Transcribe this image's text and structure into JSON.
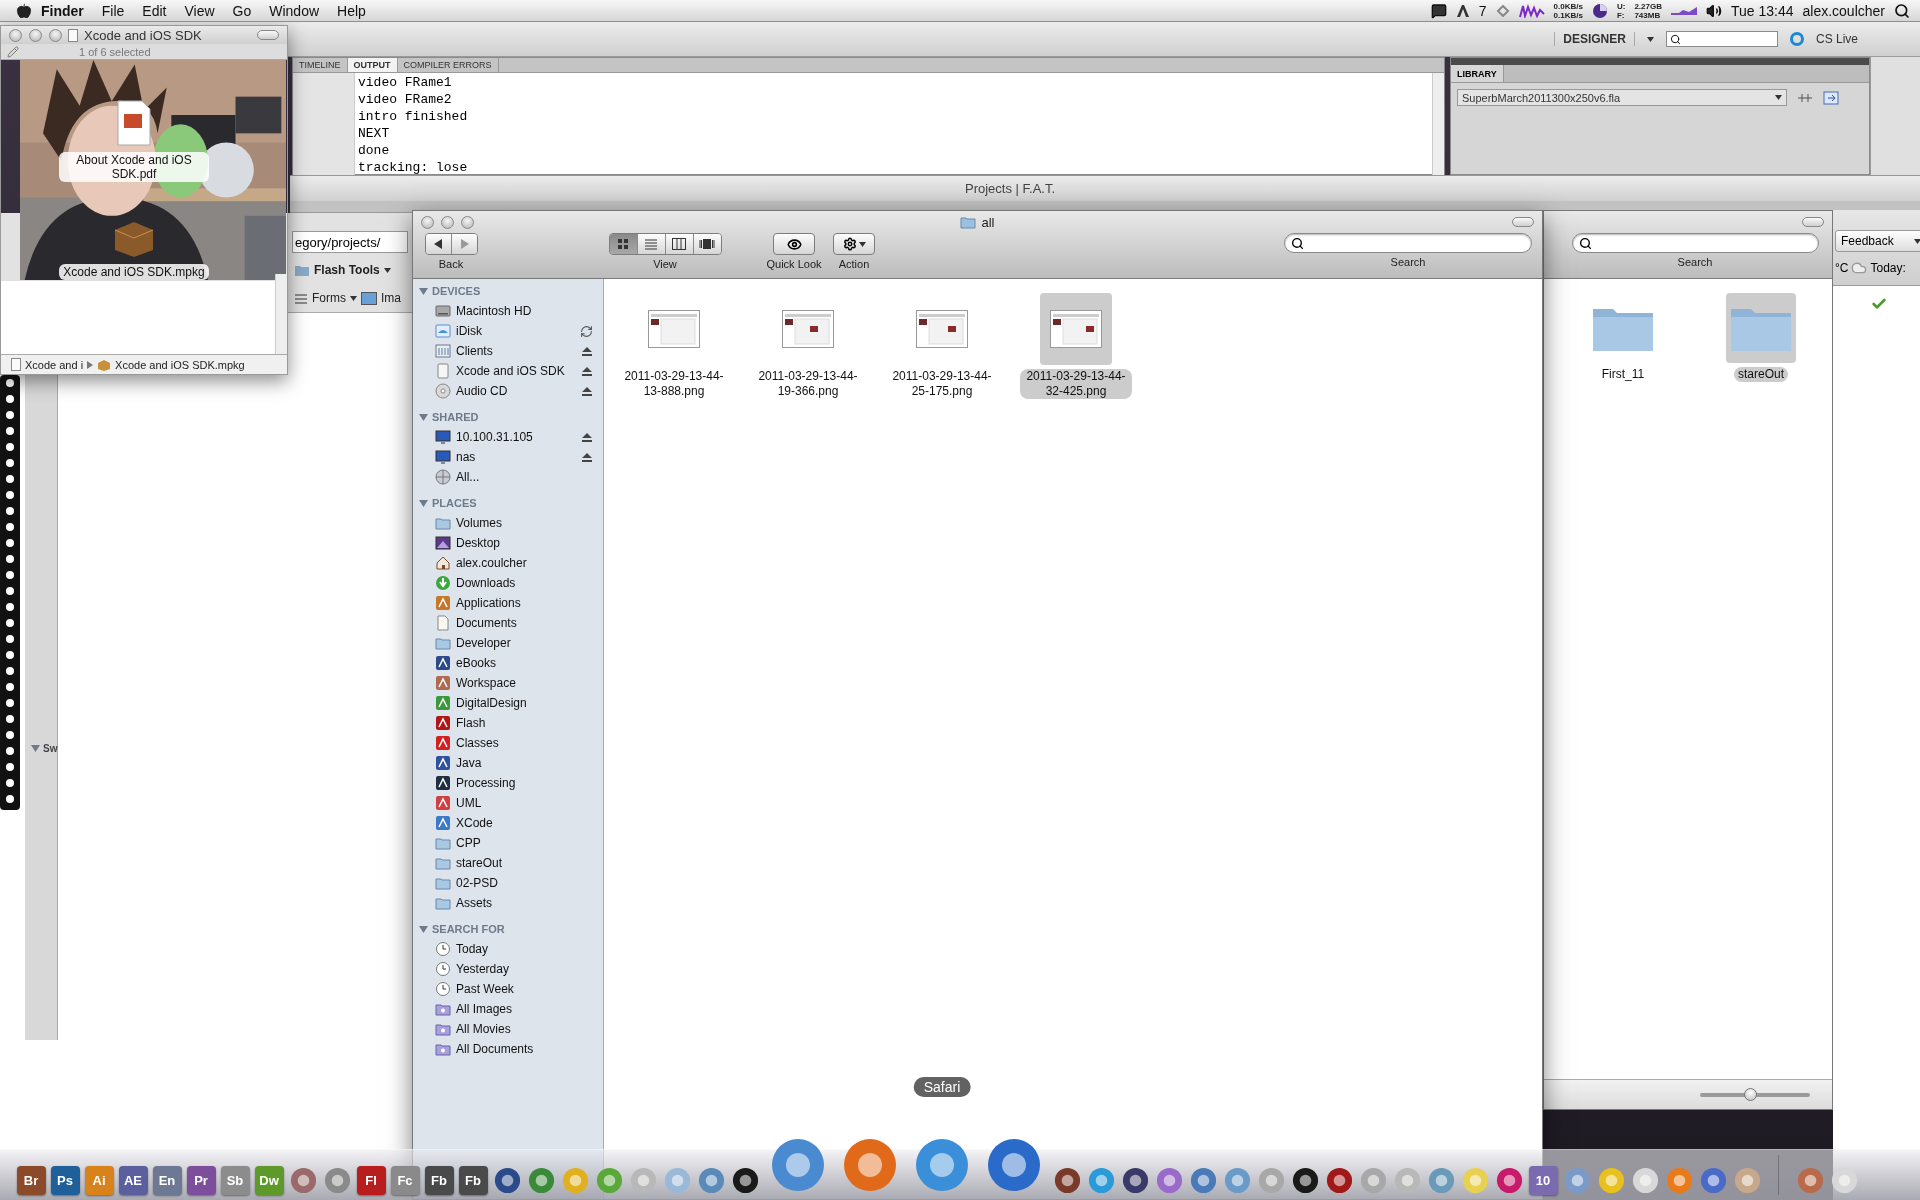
{
  "menu_bar": {
    "app": "Finder",
    "menus": [
      "File",
      "Edit",
      "View",
      "Go",
      "Window",
      "Help"
    ],
    "badge": "7",
    "net_up": "0.0KB/s",
    "net_down": "0.1KB/s",
    "mem_labels": [
      "U:",
      "F:"
    ],
    "mem_values": [
      "2.27GB",
      "743MB"
    ],
    "clock": "Tue 13:44",
    "user": "alex.coulcher"
  },
  "flash": {
    "workspace": "DESIGNER",
    "cs_live": "CS Live",
    "output_tabs": [
      {
        "label": "TIMELINE",
        "selected": false
      },
      {
        "label": "OUTPUT",
        "selected": true
      },
      {
        "label": "COMPILER ERRORS",
        "selected": false
      }
    ],
    "output_lines": [
      "video FRame1",
      "video FRame2",
      "intro finished",
      "NEXT",
      "done",
      "tracking: lose"
    ],
    "library_tab": "LIBRARY",
    "library_document": "SuperbMarch2011300x250v6.fla",
    "project_title": "Projects | F.A.T."
  },
  "browser": {
    "address": "egory/projects/",
    "folder_bar": "Flash Tools",
    "bookmarks": [
      "Forms",
      "Ima"
    ],
    "side_label": "Sw"
  },
  "xcode_window": {
    "title": "Xcode and iOS SDK",
    "status": "1 of 6 selected",
    "files": [
      "About Xcode and iOS SDK.pdf",
      "Xcode and iOS SDK.mpkg"
    ],
    "path": [
      "Xcode and i",
      "Xcode and iOS SDK.mpkg"
    ]
  },
  "finder": {
    "title": "all",
    "back_label": "Back",
    "view_label": "View",
    "view_modes": [
      {
        "kind": "icon",
        "selected": true
      },
      {
        "kind": "list",
        "selected": false
      },
      {
        "kind": "column",
        "selected": false
      },
      {
        "kind": "coverflow",
        "selected": false
      }
    ],
    "quick_look_label": "Quick Look",
    "action_label": "Action",
    "search_label": "Search",
    "sidebar": [
      {
        "heading": "DEVICES",
        "expanded": true,
        "items": [
          {
            "label": "Macintosh HD",
            "kind": "drive",
            "eject": false,
            "sync": false
          },
          {
            "label": "iDisk",
            "kind": "idisk",
            "eject": false,
            "sync": true
          },
          {
            "label": "Clients",
            "kind": "share",
            "eject": true,
            "sync": false
          },
          {
            "label": "Xcode and iOS SDK",
            "kind": "volume",
            "eject": true,
            "sync": false
          },
          {
            "label": "Audio CD",
            "kind": "cd",
            "eject": true,
            "sync": false
          }
        ]
      },
      {
        "heading": "SHARED",
        "expanded": true,
        "items": [
          {
            "label": "10.100.31.105",
            "kind": "monitor",
            "eject": true,
            "sync": false
          },
          {
            "label": "nas",
            "kind": "monitor",
            "eject": true,
            "sync": false
          },
          {
            "label": "All...",
            "kind": "globe",
            "eject": false,
            "sync": false
          }
        ]
      },
      {
        "heading": "PLACES",
        "expanded": true,
        "items": [
          {
            "label": "Volumes",
            "kind": "folder"
          },
          {
            "label": "Desktop",
            "kind": "desktop"
          },
          {
            "label": "alex.coulcher",
            "kind": "home"
          },
          {
            "label": "Downloads",
            "kind": "download"
          },
          {
            "label": "Applications",
            "kind": "app",
            "color": "#c8772a"
          },
          {
            "label": "Documents",
            "kind": "document"
          },
          {
            "label": "Developer",
            "kind": "folder"
          },
          {
            "label": "eBooks",
            "kind": "app",
            "color": "#2a4a8a"
          },
          {
            "label": "Workspace",
            "kind": "app",
            "color": "#b06a50"
          },
          {
            "label": "DigitalDesign",
            "kind": "app",
            "color": "#3a9a3a"
          },
          {
            "label": "Flash",
            "kind": "app",
            "color": "#b01818"
          },
          {
            "label": "Classes",
            "kind": "app",
            "color": "#d42020"
          },
          {
            "label": "Java",
            "kind": "app",
            "color": "#3050a0"
          },
          {
            "label": "Processing",
            "kind": "app",
            "color": "#203040"
          },
          {
            "label": "UML",
            "kind": "app",
            "color": "#d04040"
          },
          {
            "label": "XCode",
            "kind": "app",
            "color": "#3a7ac8"
          },
          {
            "label": "CPP",
            "kind": "folder"
          },
          {
            "label": "stareOut",
            "kind": "folder"
          },
          {
            "label": "02-PSD",
            "kind": "folder"
          },
          {
            "label": "Assets",
            "kind": "folder"
          }
        ]
      },
      {
        "heading": "SEARCH FOR",
        "expanded": true,
        "items": [
          {
            "label": "Today",
            "kind": "clock"
          },
          {
            "label": "Yesterday",
            "kind": "clock"
          },
          {
            "label": "Past Week",
            "kind": "clock"
          },
          {
            "label": "All Images",
            "kind": "smart"
          },
          {
            "label": "All Movies",
            "kind": "smart"
          },
          {
            "label": "All Documents",
            "kind": "smart"
          }
        ]
      }
    ],
    "files": [
      {
        "name": "2011-03-29-13-44-13-888.png",
        "selected": false
      },
      {
        "name": "2011-03-29-13-44-19-366.png",
        "selected": false
      },
      {
        "name": "2011-03-29-13-44-25-175.png",
        "selected": false
      },
      {
        "name": "2011-03-29-13-44-32-425.png",
        "selected": true
      }
    ]
  },
  "finder_right": {
    "search_label": "Search",
    "items": [
      {
        "name": "First_11",
        "selected": false
      },
      {
        "name": "stareOut",
        "selected": true
      }
    ],
    "zoom_slider": {
      "level": 0.45
    }
  },
  "side_panel": {
    "feedback": "Feedback",
    "weather": "°C",
    "today": "Today:"
  },
  "dock": {
    "items": [
      {
        "kind": "tile",
        "label": "Br",
        "color": "#8b4a2a"
      },
      {
        "kind": "tile",
        "label": "Ps",
        "color": "#1f5f9a"
      },
      {
        "kind": "tile",
        "label": "Ai",
        "color": "#d8821c"
      },
      {
        "kind": "tile",
        "label": "AE",
        "color": "#5b5f9e"
      },
      {
        "kind": "tile",
        "label": "En",
        "color": "#6c7894"
      },
      {
        "kind": "tile",
        "label": "Pr",
        "color": "#7d4e9c"
      },
      {
        "kind": "tile",
        "label": "Sb",
        "color": "#8c8c8c"
      },
      {
        "kind": "tile",
        "label": "Dw",
        "color": "#5e9a2a"
      },
      {
        "kind": "app",
        "color": "#9a6a6a"
      },
      {
        "kind": "app",
        "color": "#8a8a8a"
      },
      {
        "kind": "tile",
        "label": "Fl",
        "color": "#b81e1e"
      },
      {
        "kind": "tile",
        "label": "Fc",
        "color": "#8a8a8a"
      },
      {
        "kind": "tile",
        "label": "Fb",
        "color": "#4a4a4a"
      },
      {
        "kind": "tile",
        "label": "Fb",
        "color": "#4a4a4a"
      },
      {
        "kind": "app",
        "color": "#2a4a8a"
      },
      {
        "kind": "app",
        "color": "#3a8a3a"
      },
      {
        "kind": "app",
        "color": "#e0b020"
      },
      {
        "kind": "app",
        "color": "#5aa83a"
      },
      {
        "kind": "app",
        "color": "#b8b8b8"
      },
      {
        "kind": "app",
        "color": "#9ab8d8"
      },
      {
        "kind": "app",
        "color": "#5a8ab8"
      },
      {
        "kind": "app",
        "color": "#1a1a1a"
      },
      {
        "kind": "large",
        "color": "#4a8ad0"
      },
      {
        "kind": "large",
        "color": "#e06a1a"
      },
      {
        "kind": "large",
        "color": "#3a8fd8",
        "tooltip": "Safari"
      },
      {
        "kind": "large",
        "color": "#2a6ac8"
      },
      {
        "kind": "app",
        "color": "#7a3a2a"
      },
      {
        "kind": "app",
        "color": "#2a9ad8"
      },
      {
        "kind": "app",
        "color": "#3a3a6a"
      },
      {
        "kind": "app",
        "color": "#9a6ac8"
      },
      {
        "kind": "app",
        "color": "#4a7ab8"
      },
      {
        "kind": "app",
        "color": "#6a9ac8"
      },
      {
        "kind": "app",
        "color": "#a8a8a8"
      },
      {
        "kind": "app",
        "color": "#1a1a1a"
      },
      {
        "kind": "app",
        "color": "#a01818"
      },
      {
        "kind": "app",
        "color": "#a8a8a8"
      },
      {
        "kind": "app",
        "color": "#b8b8b8"
      },
      {
        "kind": "app",
        "color": "#6a9ab8"
      },
      {
        "kind": "app",
        "color": "#e8d050"
      },
      {
        "kind": "app",
        "color": "#c81a6a"
      },
      {
        "kind": "tile",
        "label": "10",
        "color": "#7a6ab0"
      },
      {
        "kind": "app",
        "color": "#7a9ac8"
      },
      {
        "kind": "app",
        "color": "#e8c020"
      },
      {
        "kind": "app",
        "color": "#d8d8d8"
      },
      {
        "kind": "app",
        "color": "#e87a1a"
      },
      {
        "kind": "app",
        "color": "#4a6ac8"
      },
      {
        "kind": "app",
        "color": "#c8a88a"
      },
      {
        "kind": "separator"
      },
      {
        "kind": "app",
        "color": "#b86a4a"
      },
      {
        "kind": "app",
        "color": "#d8d8d8"
      }
    ]
  }
}
